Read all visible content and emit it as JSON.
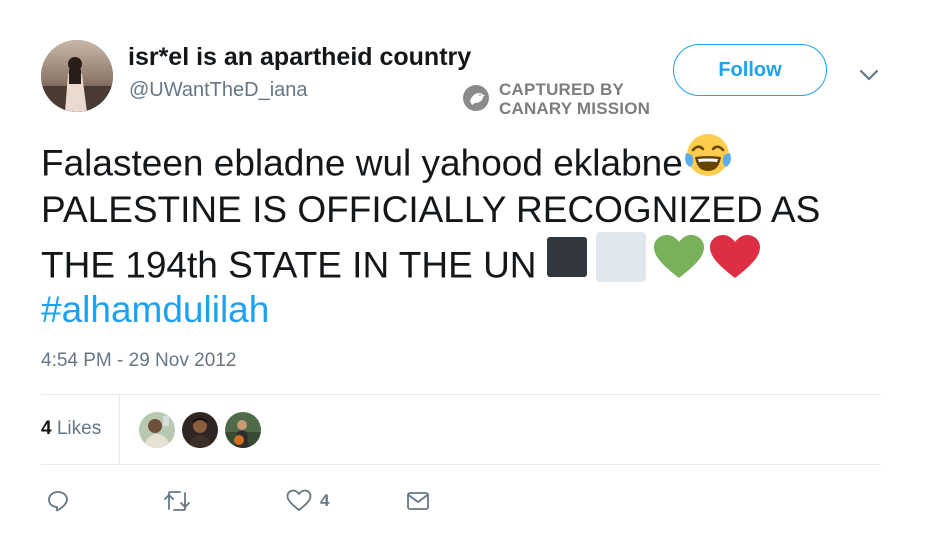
{
  "header": {
    "display_name": "isr*el is an apartheid country",
    "handle": "@UWantTheD_iana",
    "follow_label": "Follow"
  },
  "watermark": {
    "line1": "CAPTURED BY",
    "line2": "CANARY MISSION"
  },
  "tweet": {
    "line1": "Falasteen ebladne wul yahood eklabne",
    "line2": "PALESTINE IS OFFICIALLY RECOGNIZED AS",
    "line3": "THE 194th STATE IN THE UN",
    "hashtag": "#alhamdulilah",
    "emojis": [
      "face-with-tears-of-joy-icon",
      "black-square-icon",
      "white-square-icon",
      "green-heart-icon",
      "red-heart-icon"
    ]
  },
  "timestamp": "4:54 PM - 29 Nov 2012",
  "likes": {
    "count": "4",
    "label": " Likes"
  },
  "actions": {
    "like_count": "4"
  },
  "colors": {
    "accent": "#1da1f2",
    "muted": "#657786",
    "divider": "#e6ecf0",
    "heart_red": "#dd2e44",
    "heart_green": "#78b159"
  }
}
